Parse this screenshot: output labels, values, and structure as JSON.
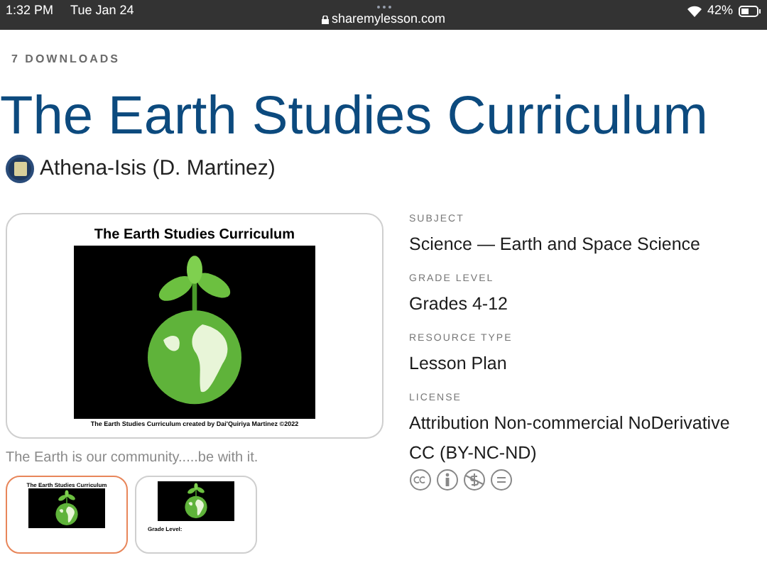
{
  "status_bar": {
    "time": "1:32 PM",
    "date": "Tue Jan 24",
    "url": "sharemylesson.com",
    "battery": "42%"
  },
  "downloads": "7 DOWNLOADS",
  "title": "The Earth Studies Curriculum",
  "author": {
    "name": "Athena-Isis (D. Martinez)"
  },
  "preview": {
    "heading": "The Earth Studies Curriculum",
    "credit": "The Earth Studies Curriculum created by Dai'Quiriya Martinez ©2022"
  },
  "description": "The Earth is our community.....be with it.",
  "thumbnails": [
    {
      "heading": "The Earth Studies Curriculum",
      "selected": true
    },
    {
      "note": "Grade Level:",
      "selected": false
    }
  ],
  "details": [
    {
      "label": "SUBJECT",
      "value": "Science — Earth and Space Science"
    },
    {
      "label": "GRADE LEVEL",
      "value": "Grades 4-12"
    },
    {
      "label": "RESOURCE TYPE",
      "value": "Lesson Plan"
    },
    {
      "label": "LICENSE",
      "value": "Attribution Non-commercial NoDerivative",
      "value2": "CC (BY-NC-ND)"
    }
  ]
}
